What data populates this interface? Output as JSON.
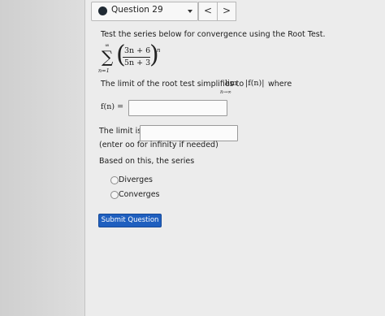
{
  "question_nav": {
    "title": "Question 29",
    "prev_glyph": "<",
    "next_glyph": ">"
  },
  "prompt": "Test the series below for convergence using the Root Test.",
  "series": {
    "sum_upper": "∞",
    "sum_lower": "n=1",
    "numerator": "3n + 6",
    "denominator": "5n + 3",
    "exponent": "n"
  },
  "simplify_text": "The limit of the root test simplifies to",
  "lim": {
    "word": "lim",
    "sub": "n→∞",
    "abs_fn": "|f(n)|",
    "where": "where"
  },
  "fn_label": "f(n) =",
  "fn_value": "",
  "limit_label": "The limit is:",
  "limit_value": "",
  "limit_hint": "(enter oo for infinity if needed)",
  "based_on": "Based on this, the series",
  "options": [
    "Diverges",
    "Converges"
  ],
  "submit_label": "Submit Question"
}
